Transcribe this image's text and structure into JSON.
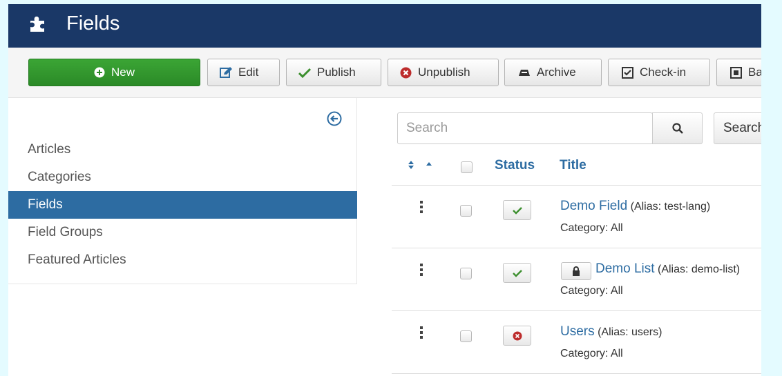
{
  "header": {
    "title": "Fields"
  },
  "toolbar": {
    "new_label": "New",
    "edit_label": "Edit",
    "publish_label": "Publish",
    "unpublish_label": "Unpublish",
    "archive_label": "Archive",
    "checkin_label": "Check-in",
    "batch_label": "Batc"
  },
  "sidebar": {
    "items": [
      {
        "label": "Articles",
        "active": false
      },
      {
        "label": "Categories",
        "active": false
      },
      {
        "label": "Fields",
        "active": true
      },
      {
        "label": "Field Groups",
        "active": false
      },
      {
        "label": "Featured Articles",
        "active": false
      }
    ]
  },
  "search": {
    "placeholder": "Search",
    "tools_label": "Search T"
  },
  "table": {
    "headers": {
      "status": "Status",
      "title": "Title"
    },
    "rows": [
      {
        "title": "Demo Field",
        "alias": "(Alias: test-lang)",
        "category": "Category: All",
        "status": "published",
        "locked": false
      },
      {
        "title": "Demo List",
        "alias": "(Alias: demo-list)",
        "category": "Category: All",
        "status": "published",
        "locked": true
      },
      {
        "title": "Users",
        "alias": "(Alias: users)",
        "category": "Category: All",
        "status": "unpublished",
        "locked": false
      }
    ]
  },
  "colors": {
    "header_bg": "#1a3867",
    "new_button": "#2b8a27",
    "active_sidebar": "#2d6ca2",
    "link": "#2d6ca2",
    "published_check": "#3c8f2e",
    "unpublished": "#bd2c2c",
    "page_border": "#e4fbff"
  },
  "icons": {
    "header": "puzzle-icon",
    "new": "plus-circle-icon",
    "edit": "edit-icon",
    "publish": "check-icon",
    "unpublish": "times-circle-icon",
    "archive": "archive-icon",
    "checkin": "checkbox-icon",
    "batch": "square-icon",
    "sidebar_toggle": "arrow-left-circle-icon",
    "search": "search-icon",
    "lock": "lock-icon",
    "drag": "drag-handle-icon"
  }
}
